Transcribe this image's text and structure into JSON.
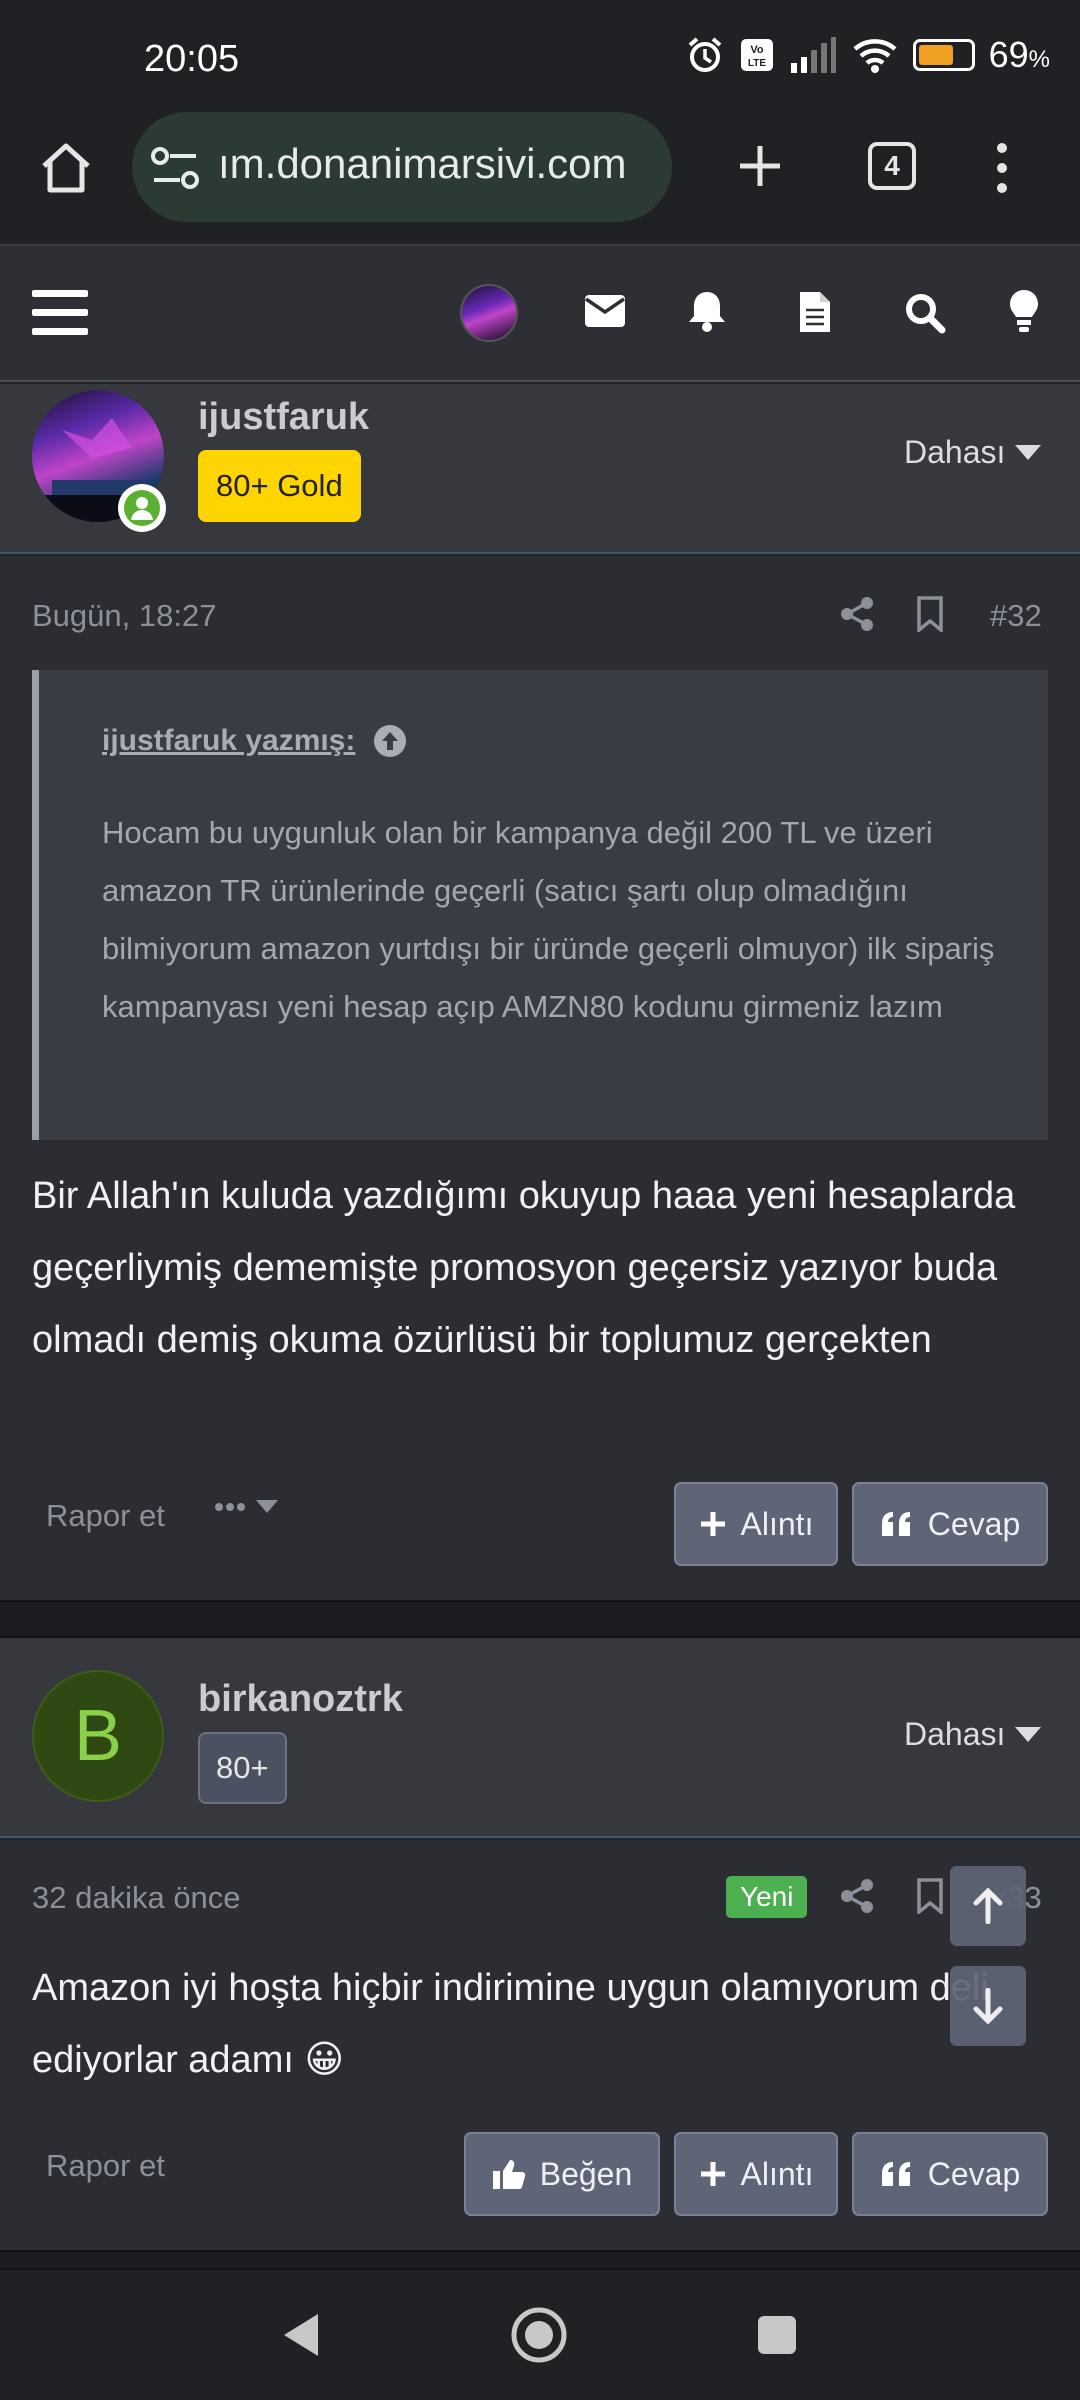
{
  "status": {
    "time": "20:05",
    "battery": "69",
    "battery_unit": "%",
    "battery_level": 0.69
  },
  "browser": {
    "url": "ım.donanimarsivi.com",
    "tab_count": "4"
  },
  "post1": {
    "username": "ijustfaruk",
    "badge": "80+ Gold",
    "more": "Dahası",
    "date": "Bugün, 18:27",
    "number": "#32",
    "quote_author": "ijustfaruk yazmış:",
    "quote_text": "Hocam bu uygunluk olan bir kampanya değil 200 TL ve üzeri amazon TR ürünlerinde geçerli (satıcı şartı olup olmadığını bilmiyorum amazon yurtdışı bir üründe geçerli olmuyor) ilk sipariş kampanyası yeni hesap açıp AMZN80 kodunu girmeniz lazım",
    "text": "Bir Allah'ın kuluda yazdığımı okuyup haaa yeni hesaplarda geçerliymiş dememişte promosyon geçersiz yazıyor buda olmadı demiş okuma özürlüsü bir toplumuz gerçekten",
    "report": "Rapor et",
    "quote_btn": "Alıntı",
    "reply_btn": "Cevap"
  },
  "post2": {
    "avatar_letter": "B",
    "username": "birkanoztrk",
    "badge": "80+",
    "more": "Dahası",
    "date": "32 dakika önce",
    "new_badge": "Yeni",
    "number": "#33",
    "text": "Amazon iyi hoşta hiçbir indirimine uygun olamıyorum deli ediyorlar adamı 😀",
    "report": "Rapor et",
    "like_btn": "Beğen",
    "quote_btn": "Alıntı",
    "reply_btn": "Cevap"
  },
  "colors": {
    "gold_badge": "#ffd500",
    "online": "#5ab030",
    "new_badge": "#4caf50",
    "button": "#5d6576"
  }
}
